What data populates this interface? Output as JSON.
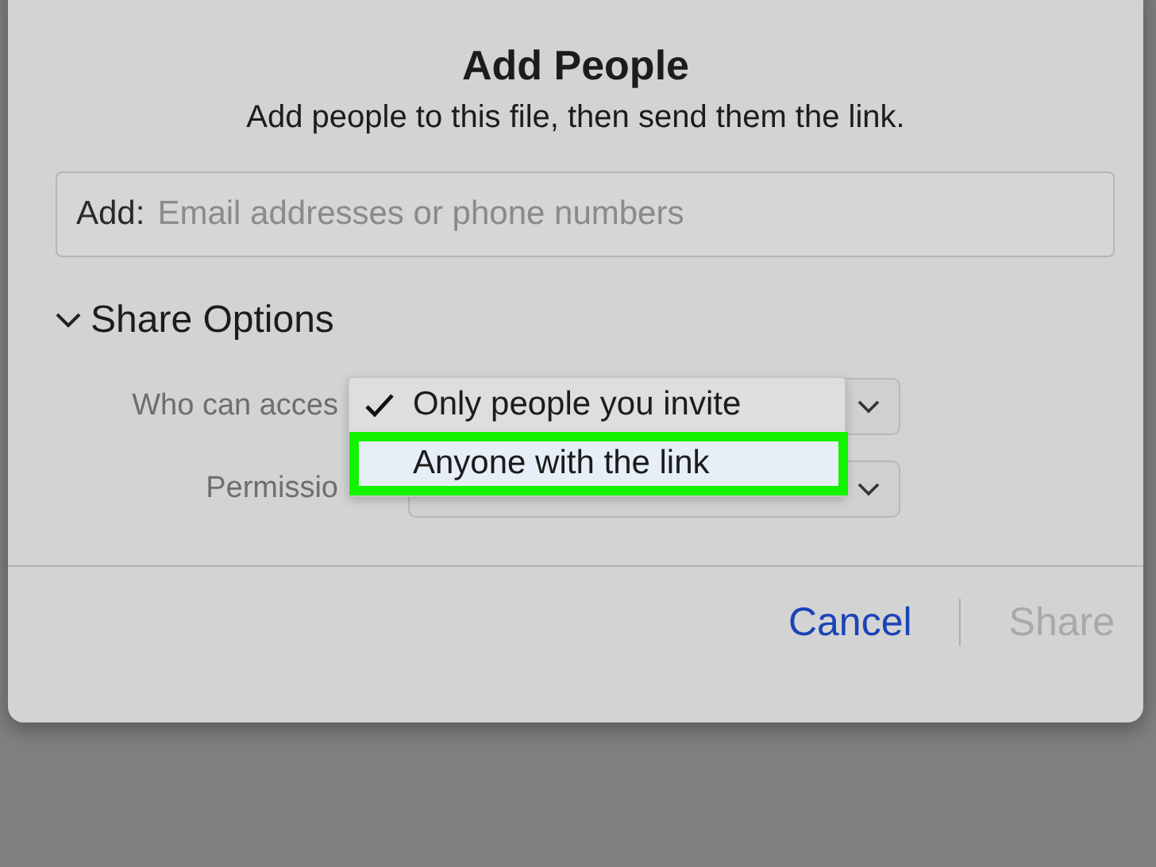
{
  "dialog": {
    "title": "Add People",
    "subtitle": "Add people to this file, then send them the link."
  },
  "add_field": {
    "label": "Add:",
    "placeholder": "Email addresses or phone numbers"
  },
  "share_options": {
    "label": "Share Options",
    "expanded": true,
    "rows": [
      {
        "label": "Who can acces"
      },
      {
        "label": "Permissio"
      }
    ]
  },
  "dropdown": {
    "options": [
      {
        "label": "Only people you invite",
        "checked": true,
        "highlighted": false
      },
      {
        "label": "Anyone with the link",
        "checked": false,
        "highlighted": true
      }
    ]
  },
  "buttons": [
    {
      "label": "Cancel",
      "disabled": false
    },
    {
      "label": "Share",
      "disabled": true
    }
  ]
}
